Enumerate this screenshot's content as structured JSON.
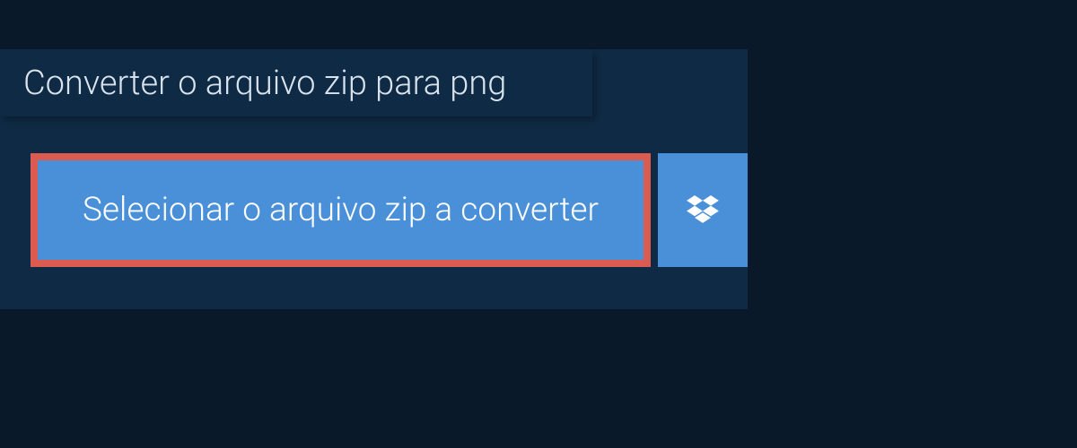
{
  "title": "Converter o arquivo zip para png",
  "buttons": {
    "select_file": "Selecionar o arquivo zip a converter"
  },
  "colors": {
    "page_bg": "#0a1929",
    "panel_bg": "#0f2a44",
    "button_bg": "#4a90d9",
    "highlight_border": "#db5b51",
    "title_text": "#d9e3ed",
    "button_text": "#ffffff"
  }
}
